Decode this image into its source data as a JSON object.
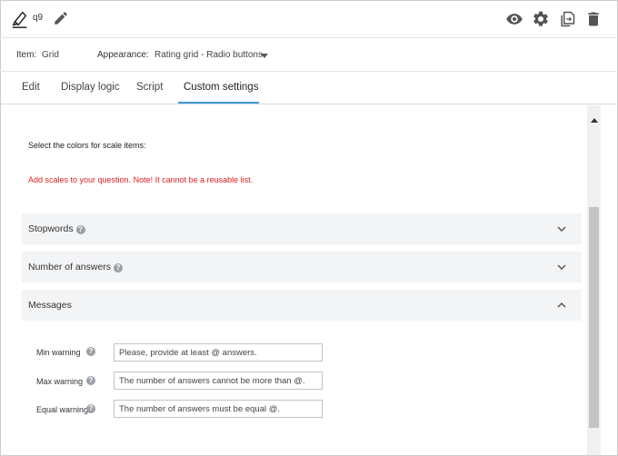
{
  "header": {
    "question_name": "q9",
    "icons": [
      "highlighter-icon",
      "pencil-icon",
      "eye-icon",
      "gear-icon",
      "copy-icon",
      "trash-icon"
    ]
  },
  "itembar": {
    "item_label": "Item:",
    "item_value": "Grid",
    "appearance_label": "Appearance:",
    "appearance_value": "Rating grid - Radio buttons"
  },
  "tabs": [
    {
      "label": "Edit"
    },
    {
      "label": "Display logic"
    },
    {
      "label": "Script"
    },
    {
      "label": "Custom settings",
      "active": true
    }
  ],
  "content": {
    "lead_text": "Select the colors for scale items:",
    "warning_text": "Add scales to your question. Note! It cannot be a reusable list.",
    "panels": [
      {
        "title": "Stopwords",
        "expanded": false
      },
      {
        "title": "Number of answers",
        "expanded": false
      },
      {
        "title": "Messages",
        "expanded": true
      }
    ],
    "messages": [
      {
        "label": "Min warning",
        "value": "Please, provide at least @ answers."
      },
      {
        "label": "Max warning",
        "value": "The number of answers cannot be more than @."
      },
      {
        "label": "Equal warning",
        "value": "The number of answers must be equal @."
      }
    ],
    "help_glyph": "?"
  },
  "colors": {
    "accent": "#3e9cd6",
    "warning": "#e02020",
    "panel_bg": "#f3f4f6"
  }
}
